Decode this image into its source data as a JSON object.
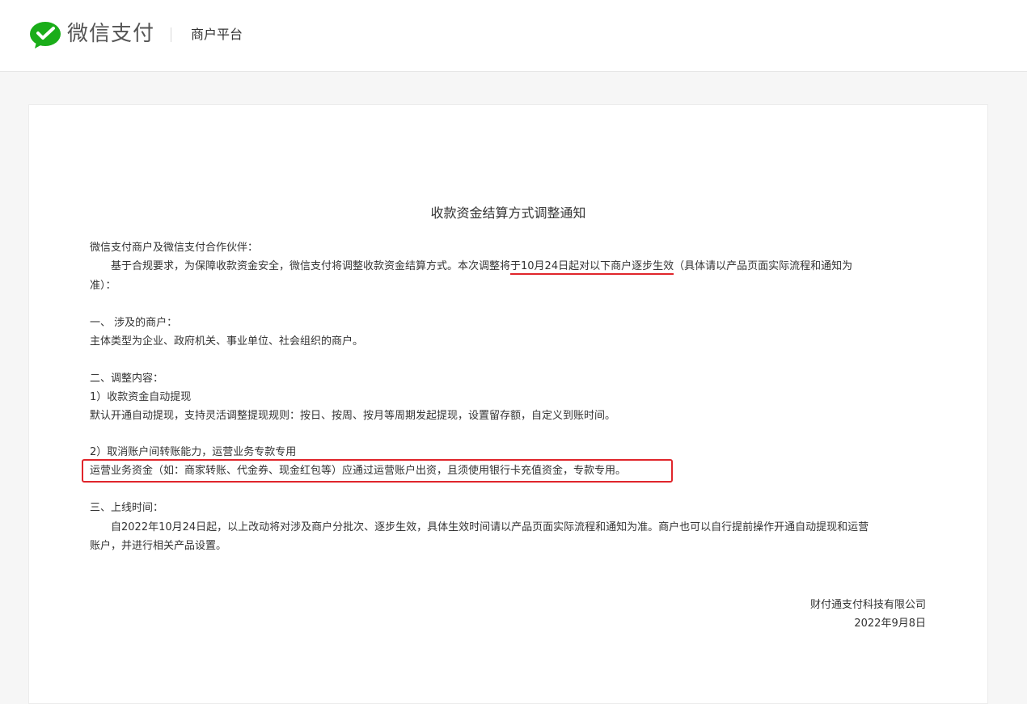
{
  "header": {
    "brand": "微信支付",
    "platform": "商户平台"
  },
  "notice": {
    "title": "收款资金结算方式调整通知",
    "greeting": "微信支付商户及微信支付合作伙伴：",
    "intro_a": "基于合规要求，为保障收款资金安全，微信支付将调整收款资金结算方式。本次调整将",
    "intro_highlight_1": "于10月24日起",
    "intro_highlight_2": "对以下商户逐步生效",
    "intro_b": "（具体请以产品页面实际流程和通知为",
    "intro_c": "准）：",
    "s1_heading": "一、 涉及的商户：",
    "s1_body": "主体类型为企业、政府机关、事业单位、社会组织的商户。",
    "s2_heading": "二、调整内容：",
    "s2_item1_title": "1）收款资金自动提现",
    "s2_item1_body": "默认开通自动提现，支持灵活调整提现规则：按日、按周、按月等周期发起提现，设置留存额，自定义到账时间。",
    "s2_item2_title": "2）取消账户间转账能力，运营业务专款专用",
    "s2_item2_body": "运营业务资金（如：商家转账、代金券、现金红包等）应通过运营账户出资，且须使用银行卡充值资金，专款专用。",
    "s3_heading": "三、上线时间：",
    "s3_body_a": "自2022年10月24日起，以上改动将对涉及商户分批次、逐步生效，具体生效时间请以产品页面实际流程和通知为准。商户也可以自行提前操作开通自动提现和运营",
    "s3_body_b": "账户，并进行相关产品设置。",
    "signature_company": "财付通支付科技有限公司",
    "signature_date": "2022年9月8日"
  },
  "colors": {
    "brand_green": "#1aad19",
    "highlight_red": "#e0252b"
  },
  "icons": {
    "logo": "wechat-pay-logo-icon"
  }
}
